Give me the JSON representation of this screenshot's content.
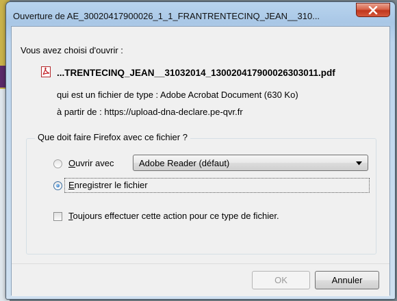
{
  "window": {
    "title": "Ouverture de AE_30020417900026_1_1_FRANTRENTECINQ_JEAN__310..."
  },
  "dialog": {
    "intro": "Vous avez choisi d'ouvrir :",
    "file_name": "...TRENTECINQ_JEAN__31032014_13002041790002630​3011.pdf",
    "file_type_line": "qui est un fichier de type : Adobe Acrobat Document (630 Ko)",
    "source_line": "à partir de : https://upload-dna-declare.pe-qvr.fr",
    "group_label": "Que doit faire Firefox avec ce fichier ?",
    "open_with": {
      "accel": "O",
      "rest": "uvrir avec",
      "selected": false,
      "app_selected": "Adobe Reader  (défaut)"
    },
    "save_file": {
      "accel": "E",
      "rest": "nregistrer le fichier",
      "selected": true
    },
    "always_do": {
      "accel": "T",
      "rest": "oujours effectuer cette action pour ce type de fichier.",
      "checked": false
    },
    "buttons": {
      "ok": "OK",
      "cancel": "Annuler"
    }
  },
  "icons": {
    "file": "pdf-file-icon",
    "close": "close-icon",
    "dropdown": "chevron-down-icon"
  },
  "colors": {
    "close_button": "#c7452a",
    "titlebar": "#b8d4ee",
    "client_bg": "#f0f0f0"
  }
}
